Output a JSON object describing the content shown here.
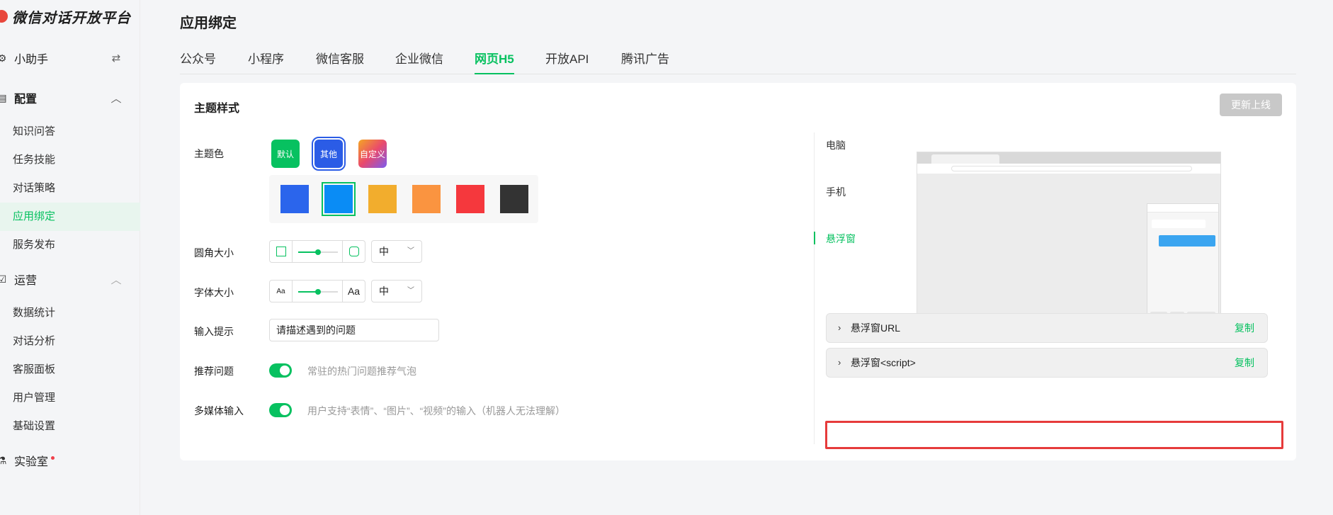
{
  "brand": {
    "name": "微信对话开放平台"
  },
  "sidebar": {
    "assistant": {
      "label": "小助手",
      "switch_icon": "swap-icon"
    },
    "config": {
      "label": "配置",
      "items": [
        {
          "label": "知识问答"
        },
        {
          "label": "任务技能"
        },
        {
          "label": "对话策略"
        },
        {
          "label": "应用绑定",
          "active": true
        },
        {
          "label": "服务发布"
        }
      ]
    },
    "ops": {
      "label": "运营",
      "items": [
        {
          "label": "数据统计"
        },
        {
          "label": "对话分析"
        },
        {
          "label": "客服面板"
        },
        {
          "label": "用户管理"
        },
        {
          "label": "基础设置"
        }
      ]
    },
    "lab": {
      "label": "实验室"
    }
  },
  "header": {
    "title": "应用绑定",
    "tabs": [
      {
        "label": "公众号"
      },
      {
        "label": "小程序"
      },
      {
        "label": "微信客服"
      },
      {
        "label": "企业微信"
      },
      {
        "label": "网页H5",
        "active": true
      },
      {
        "label": "开放API"
      },
      {
        "label": "腾讯广告"
      }
    ]
  },
  "card": {
    "title": "主题样式",
    "update_button": "更新上线",
    "theme": {
      "label": "主题色",
      "buttons": [
        {
          "label": "默认",
          "color": "#07c160"
        },
        {
          "label": "其他",
          "color": "#2b5ce6",
          "selected": true
        },
        {
          "label": "自定义",
          "color": "gradient"
        }
      ],
      "swatches": [
        "#2b65ec",
        "#0a8cf5",
        "#f2ad2d",
        "#fa9440",
        "#f5383d",
        "#333333"
      ],
      "selected_swatch": 1
    },
    "radius": {
      "label": "圆角大小",
      "value": "中",
      "level": 0.5
    },
    "font_size": {
      "label": "字体大小",
      "value": "中",
      "small_icon": "Aa",
      "large_icon": "Aa",
      "level": 0.5
    },
    "input_hint": {
      "label": "输入提示",
      "value": "请描述遇到的问题"
    },
    "recommend": {
      "label": "推荐问题",
      "enabled": true,
      "hint": "常驻的热门问题推荐气泡"
    },
    "media": {
      "label": "多媒体输入",
      "enabled": true,
      "hint": "用户支持“表情”、“图片”、“视频”的输入（机器人无法理解）"
    },
    "preview_tabs": [
      {
        "label": "电脑"
      },
      {
        "label": "手机"
      },
      {
        "label": "悬浮窗",
        "active": true
      }
    ],
    "collapses": [
      {
        "label": "悬浮窗URL",
        "copy": "复制"
      },
      {
        "label": "悬浮窗<script>",
        "copy": "复制"
      }
    ]
  }
}
